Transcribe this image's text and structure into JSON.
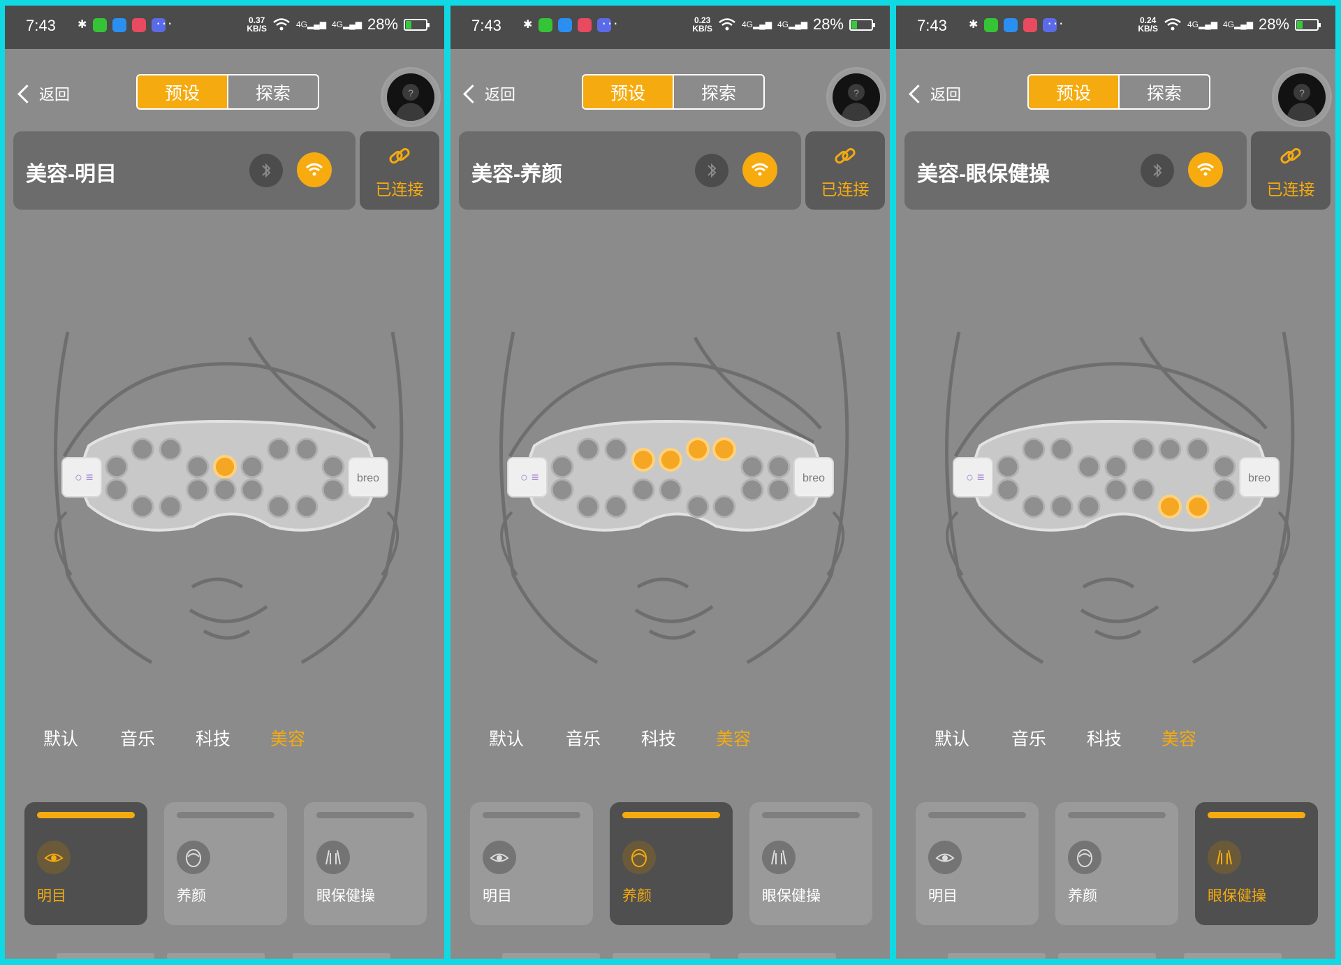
{
  "colors": {
    "accent": "#f5ab0f",
    "background": "#8b8b8b",
    "border": "#11d9e3",
    "statusbar": "#4b4b4b"
  },
  "panels": [
    {
      "status": {
        "time": "7:43",
        "speed_value": "0.37",
        "speed_unit": "KB/S",
        "network1": "4G",
        "network2": "4G",
        "battery": "28%",
        "battery_level": 0.28
      },
      "back_label": "返回",
      "segment": {
        "preset": "预设",
        "explore": "探索"
      },
      "mode_title": "美容-明目",
      "connected_label": "已连接",
      "tabs": [
        "默认",
        "音乐",
        "科技",
        "美容"
      ],
      "active_tab": 3,
      "cards": [
        {
          "label": "明目",
          "icon": "eye-icon"
        },
        {
          "label": "养颜",
          "icon": "face-icon"
        },
        {
          "label": "眼保健操",
          "icon": "hands-icon"
        }
      ],
      "active_card": 0,
      "device_brand": "breo",
      "active_nodes": [
        4
      ]
    },
    {
      "status": {
        "time": "7:43",
        "speed_value": "0.23",
        "speed_unit": "KB/S",
        "network1": "4G",
        "network2": "4G",
        "battery": "28%",
        "battery_level": 0.28
      },
      "back_label": "返回",
      "segment": {
        "preset": "预设",
        "explore": "探索"
      },
      "mode_title": "美容-养颜",
      "connected_label": "已连接",
      "tabs": [
        "默认",
        "音乐",
        "科技",
        "美容"
      ],
      "active_tab": 3,
      "cards": [
        {
          "label": "明目",
          "icon": "eye-icon"
        },
        {
          "label": "养颜",
          "icon": "face-icon"
        },
        {
          "label": "眼保健操",
          "icon": "hands-icon"
        }
      ],
      "active_card": 1,
      "device_brand": "breo",
      "active_nodes": [
        3,
        4,
        5,
        6
      ]
    },
    {
      "status": {
        "time": "7:43",
        "speed_value": "0.24",
        "speed_unit": "KB/S",
        "network1": "4G",
        "network2": "4G",
        "battery": "28%",
        "battery_level": 0.28
      },
      "back_label": "返回",
      "segment": {
        "preset": "预设",
        "explore": "探索"
      },
      "mode_title": "美容-眼保健操",
      "connected_label": "已连接",
      "tabs": [
        "默认",
        "音乐",
        "科技",
        "美容"
      ],
      "active_tab": 3,
      "cards": [
        {
          "label": "明目",
          "icon": "eye-icon"
        },
        {
          "label": "养颜",
          "icon": "face-icon"
        },
        {
          "label": "眼保健操",
          "icon": "hands-icon"
        }
      ],
      "active_card": 2,
      "device_brand": "breo",
      "active_nodes": [
        15,
        16
      ]
    }
  ]
}
